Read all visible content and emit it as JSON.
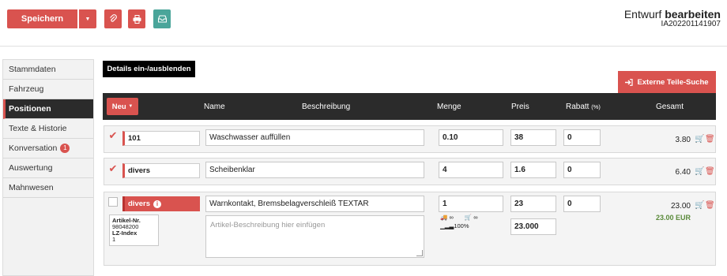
{
  "toolbar": {
    "save_label": "Speichern",
    "caret_icon": "caret-down-icon",
    "attach_icon": "paperclip-icon",
    "print_icon": "printer-icon",
    "inbox_icon": "inbox-icon",
    "title_light": "Entwurf",
    "title_bold": "bearbeiten",
    "doc_number": "IA202201141907"
  },
  "sidebar": {
    "items": [
      {
        "label": "Stammdaten"
      },
      {
        "label": "Fahrzeug"
      },
      {
        "label": "Positionen"
      },
      {
        "label": "Texte & Historie"
      },
      {
        "label": "Konversation",
        "badge": "1"
      },
      {
        "label": "Auswertung"
      },
      {
        "label": "Mahnwesen"
      }
    ]
  },
  "main": {
    "toggle_details": "Details ein-/ausblenden",
    "external_parts": "Externe Teile-Suche",
    "new_label": "Neu",
    "columns": {
      "name": "Name",
      "description": "Beschreibung",
      "quantity": "Menge",
      "price": "Preis",
      "discount": "Rabatt",
      "discount_unit": "(%)",
      "total": "Gesamt"
    },
    "rows": [
      {
        "checked": true,
        "article": "101",
        "name": "Waschwasser auffüllen",
        "quantity": "0.10",
        "price": "38",
        "discount": "0",
        "total": "3.80"
      },
      {
        "checked": true,
        "article": "divers",
        "name": "Scheibenklar",
        "quantity": "4",
        "price": "1.6",
        "discount": "0",
        "total": "6.40"
      },
      {
        "checked": false,
        "article": "divers",
        "name": "Warnkontakt, Bremsbelagverschleiß TEXTAR",
        "quantity": "1",
        "price": "23",
        "discount": "0",
        "total": "23.00",
        "total_eur": "23.00 EUR",
        "price_extra": "23.000",
        "description_placeholder": "Artikel-Beschreibung hier einfügen",
        "stock_truck": "∞",
        "stock_cart": "∞",
        "signal": "100%",
        "artinfo": {
          "nr_label": "Artikel-Nr.",
          "nr_value": "98048200",
          "lz_label": "LZ-Index",
          "lz_value": "1"
        }
      }
    ]
  },
  "colors": {
    "accent": "#d9534f",
    "dark": "#2b2b2b",
    "teal": "#4aa59a",
    "green": "#5a8a3a"
  }
}
